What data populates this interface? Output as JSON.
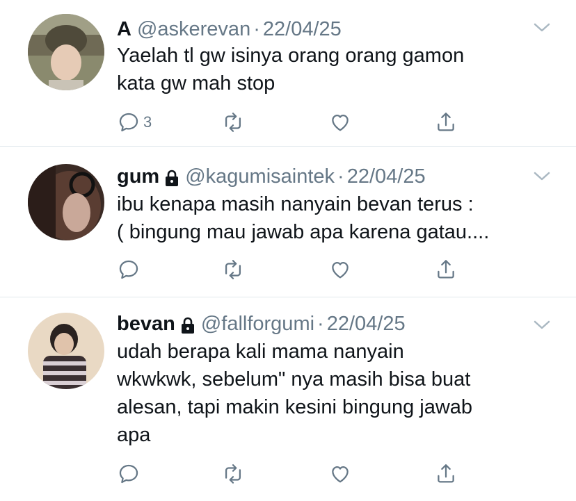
{
  "tweets": [
    {
      "name": "A",
      "locked": false,
      "handle": "@askerevan",
      "separator": "·",
      "date": "22/04/25",
      "lines": [
        "Yaelah tl gw isinya orang orang gamon",
        "kata gw mah stop"
      ],
      "reply_count": "3"
    },
    {
      "name": "gum",
      "locked": true,
      "handle": "@kagumisaintek",
      "separator": "·",
      "date": "22/04/25",
      "lines": [
        "ibu kenapa masih nanyain bevan terus :",
        "( bingung mau jawab apa karena gatau...."
      ],
      "reply_count": ""
    },
    {
      "name": "bevan",
      "locked": true,
      "handle": "@fallforgumi",
      "separator": "·",
      "date": "22/04/25",
      "lines": [
        "udah berapa kali mama nanyain",
        "wkwkwk, sebelum\" nya masih bisa buat",
        "alesan, tapi makin kesini bingung jawab",
        "apa"
      ],
      "reply_count": ""
    }
  ],
  "icons": {
    "reply": "reply-icon",
    "retweet": "retweet-icon",
    "like": "heart-icon",
    "share": "share-icon",
    "more": "chevron-down-icon",
    "lock": "lock-icon"
  },
  "colors": {
    "text": "#0f1419",
    "muted": "#657786",
    "divider": "#e1e8ed",
    "icon": "#657786"
  }
}
